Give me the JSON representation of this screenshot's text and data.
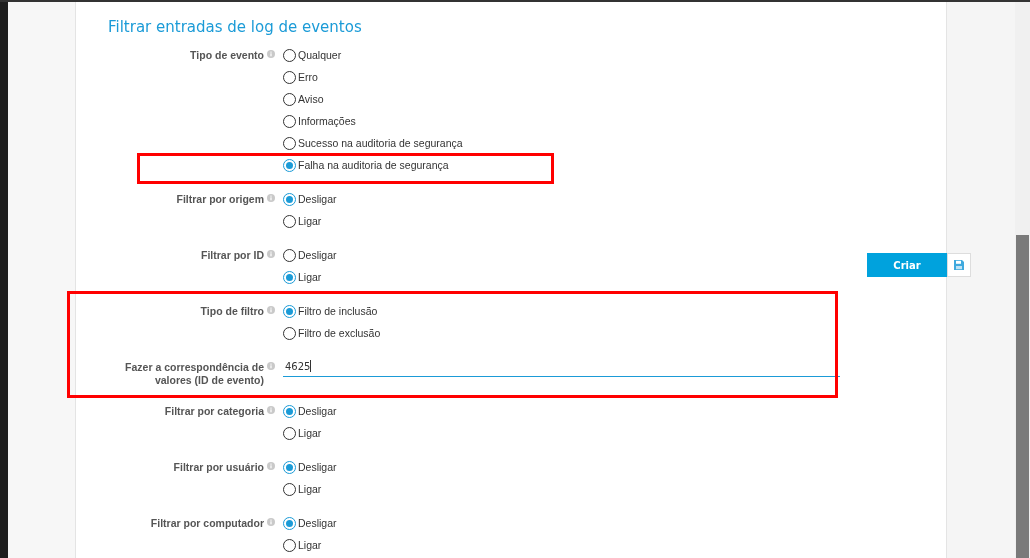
{
  "title": "Filtrar entradas de log de eventos",
  "groups": [
    {
      "label": "Tipo de evento",
      "kind": "radio",
      "options": [
        {
          "label": "Qualquer",
          "selected": false
        },
        {
          "label": "Erro",
          "selected": false
        },
        {
          "label": "Aviso",
          "selected": false
        },
        {
          "label": "Informações",
          "selected": false
        },
        {
          "label": "Sucesso na auditoria de segurança",
          "selected": false
        },
        {
          "label": "Falha na auditoria de segurança",
          "selected": true
        }
      ]
    },
    {
      "label": "Filtrar por origem",
      "kind": "radio",
      "options": [
        {
          "label": "Desligar",
          "selected": true
        },
        {
          "label": "Ligar",
          "selected": false
        }
      ]
    },
    {
      "label": "Filtrar por ID",
      "kind": "radio",
      "options": [
        {
          "label": "Desligar",
          "selected": false
        },
        {
          "label": "Ligar",
          "selected": true
        }
      ]
    },
    {
      "label": "Tipo de filtro",
      "kind": "radio",
      "options": [
        {
          "label": "Filtro de inclusão",
          "selected": true
        },
        {
          "label": "Filtro de exclusão",
          "selected": false
        }
      ]
    },
    {
      "label": "Fazer a correspondência de valores (ID de evento)",
      "kind": "field",
      "value": "4625"
    },
    {
      "label": "Filtrar por categoria",
      "kind": "radio",
      "options": [
        {
          "label": "Desligar",
          "selected": true
        },
        {
          "label": "Ligar",
          "selected": false
        }
      ]
    },
    {
      "label": "Filtrar por usuário",
      "kind": "radio",
      "options": [
        {
          "label": "Desligar",
          "selected": true
        },
        {
          "label": "Ligar",
          "selected": false
        }
      ]
    },
    {
      "label": "Filtrar por computador",
      "kind": "radio",
      "options": [
        {
          "label": "Desligar",
          "selected": true
        },
        {
          "label": "Ligar",
          "selected": false
        }
      ]
    }
  ],
  "create_button": "Criar",
  "annotations": [
    {
      "kind": "frame"
    },
    {
      "kind": "frame"
    }
  ]
}
